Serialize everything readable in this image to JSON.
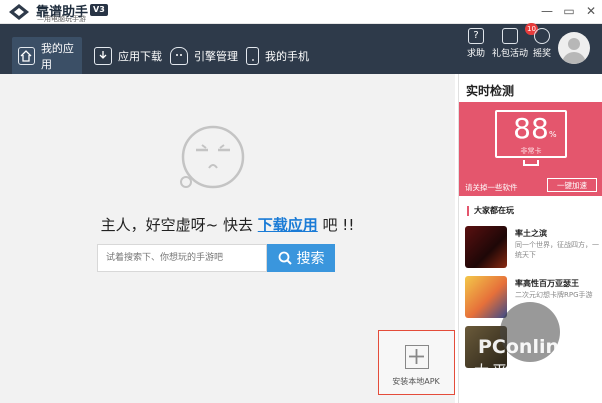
{
  "app": {
    "name": "靠谱助手",
    "version": "V3",
    "slogan": "—用电脑玩手游"
  },
  "window_controls": {
    "minimize": "—",
    "restore": "▭",
    "close": "✕"
  },
  "nav": {
    "tabs": [
      {
        "label": "我的应用",
        "icon": "home-icon"
      },
      {
        "label": "应用下载",
        "icon": "download-icon"
      },
      {
        "label": "引擎管理",
        "icon": "android-icon"
      },
      {
        "label": "我的手机",
        "icon": "phone-icon"
      }
    ],
    "help_label": "求助",
    "gift_label": "礼包活动",
    "gift_badge": "10",
    "lottery_label": "摇奖"
  },
  "main": {
    "empty_prefix": "主人，好空虚呀~ 快去 ",
    "empty_link": "下载应用",
    "empty_suffix": " 吧 !!",
    "search_placeholder": "试着搜索下、你想玩的手游吧",
    "search_button": "搜索",
    "install_label": "安装本地APK"
  },
  "side": {
    "title": "实时检测",
    "score": "88",
    "score_unit": "%",
    "score_sub": "非常卡",
    "hint": "请关掉一些软件",
    "accel_button": "一键加速",
    "popular_title": "大家都在玩",
    "games": [
      {
        "name": "率土之滨",
        "desc": "同一个世界，征战四方，一统天下"
      },
      {
        "name": "率高性百万亚瑟王",
        "desc": "二次元幻想卡牌RPG手游"
      }
    ]
  },
  "watermark": {
    "brand": "PConline",
    "cn": "太平洋电脑网"
  },
  "colors": {
    "nav": "#2e3a4a",
    "accent": "#3a96dd",
    "monitor": "#e4566d",
    "link": "#1a7bd6"
  }
}
